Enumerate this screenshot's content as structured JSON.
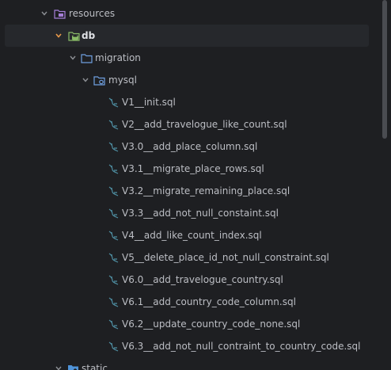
{
  "project_tree": {
    "resources_label": "resources",
    "db_label": "db",
    "migration_label": "migration",
    "mysql_label": "mysql",
    "files": [
      "V1__init.sql",
      "V2__add_travelogue_like_count.sql",
      "V3.0__add_place_column.sql",
      "V3.1__migrate_place_rows.sql",
      "V3.2__migrate_remaining_place.sql",
      "V3.3__add_not_null_constaint.sql",
      "V4__add_like_count_index.sql",
      "V5__delete_place_id_not_null_constraint.sql",
      "V6.0__add_travelogue_country.sql",
      "V6.1__add_country_code_column.sql",
      "V6.2__update_country_code_none.sql",
      "V6.3__add_not_null_contraint_to_country_code.sql"
    ],
    "static_label": "static"
  },
  "icons": {
    "chevron": "chevron-down-icon",
    "resources_folder": "resources-folder-icon",
    "db_folder": "database-folder-icon",
    "folder": "folder-icon",
    "package_folder": "package-folder-icon",
    "sql_file": "mysql-file-icon"
  },
  "colors": {
    "background": "#1e1f22",
    "selected_row": "#26282c",
    "text": "#bcbec4",
    "resources_icon": "#a57fd8",
    "db_icon": "#89bb67",
    "folder_icon": "#6f9fe0",
    "sql_icon": "#4f8fa3",
    "selected_chevron": "#e8994a"
  }
}
